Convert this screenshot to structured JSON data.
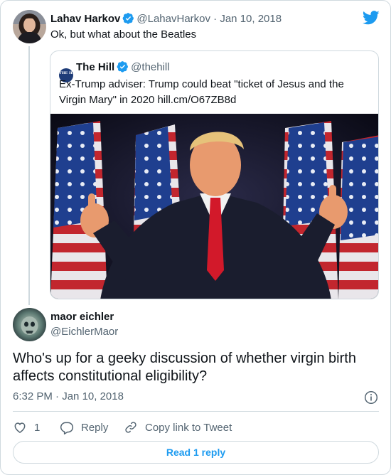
{
  "colors": {
    "brand_blue": "#1d9bf0",
    "text_primary": "#0f1419",
    "text_secondary": "#536471",
    "border": "#cfd9de"
  },
  "tweet1": {
    "name": "Lahav Harkov",
    "handle": "@LahavHarkov",
    "date_sep": " · ",
    "date": "Jan 10, 2018",
    "text": "Ok, but what about the Beatles",
    "quote": {
      "name": "The Hill",
      "handle": "@thehill",
      "logo_text": "THE HILL",
      "text": "Ex-Trump adviser: Trump could beat \"ticket of Jesus and the Virgin Mary\" in 2020 hill.cm/O67ZB8d",
      "image_alt": "Donald Trump giving two thumbs up in front of American flags"
    }
  },
  "tweet2": {
    "name": "maor eichler",
    "handle": "@EichlerMaor",
    "text": "Who's up for a geeky discussion of whether virgin birth affects constitutional eligibility?",
    "time": "6:32 PM",
    "sep": " · ",
    "date": "Jan 10, 2018"
  },
  "actions": {
    "like_count": "1",
    "reply_label": "Reply",
    "copy_label": "Copy link to Tweet"
  },
  "read_replies_label": "Read 1 reply",
  "icons": [
    "twitter-logo-icon",
    "verified-icon",
    "info-icon",
    "heart-icon",
    "reply-icon",
    "link-icon"
  ]
}
